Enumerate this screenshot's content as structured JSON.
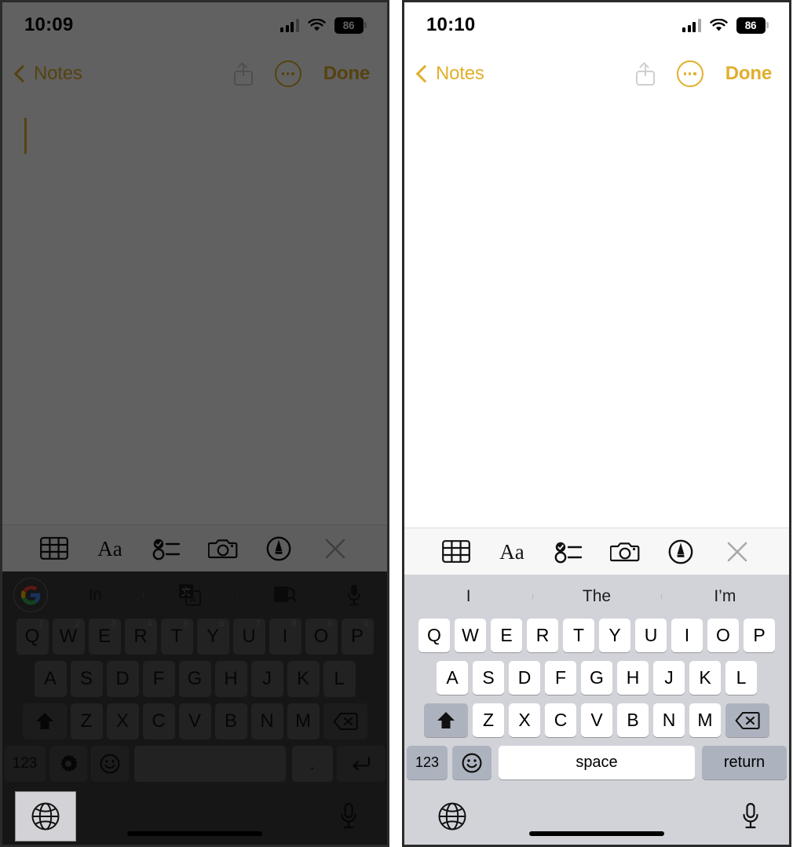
{
  "panels": [
    {
      "id": "left",
      "state": "dimmed",
      "status": {
        "time": "10:09",
        "battery": "86",
        "signal_icon": "cellular-bars-icon",
        "wifi_icon": "wifi-icon"
      },
      "navbar": {
        "back_label": "Notes",
        "back_icon": "chevron-left-icon",
        "share_icon": "share-icon",
        "more_icon": "ellipsis-circle-icon",
        "done_label": "Done"
      },
      "note": {
        "body_text": "",
        "caret": true
      },
      "toolbar": [
        {
          "name": "table-icon",
          "label": "Table"
        },
        {
          "name": "text-format-icon",
          "label": "Aa"
        },
        {
          "name": "checklist-icon",
          "label": "Checklist"
        },
        {
          "name": "camera-icon",
          "label": "Camera"
        },
        {
          "name": "markup-pen-icon",
          "label": "Markup"
        },
        {
          "name": "close-icon",
          "label": "Close"
        }
      ],
      "keyboard": {
        "type": "gboard",
        "suggestion_bar": {
          "logo_icon": "google-logo-icon",
          "suggestion": "In",
          "translate_icon": "google-translate-icon",
          "lens_icon": "google-lens-icon",
          "mic_icon": "microphone-icon"
        },
        "row1": [
          {
            "k": "Q",
            "n": "1"
          },
          {
            "k": "W",
            "n": "2"
          },
          {
            "k": "E",
            "n": "3"
          },
          {
            "k": "R",
            "n": "4"
          },
          {
            "k": "T",
            "n": "5"
          },
          {
            "k": "Y",
            "n": "6"
          },
          {
            "k": "U",
            "n": "7"
          },
          {
            "k": "I",
            "n": "8"
          },
          {
            "k": "O",
            "n": "9"
          },
          {
            "k": "P",
            "n": "0"
          }
        ],
        "row2": [
          "A",
          "S",
          "D",
          "F",
          "G",
          "H",
          "J",
          "K",
          "L"
        ],
        "row3": [
          "Z",
          "X",
          "C",
          "V",
          "B",
          "N",
          "M"
        ],
        "shift_icon": "shift-arrow-icon",
        "delete_icon": "delete-backward-icon",
        "numbers_label": "123",
        "settings_icon": "gear-icon",
        "emoji_icon": "emoji-smiley-icon",
        "space_label": "",
        "period_label": ".",
        "return_icon": "return-arrow-icon",
        "globe_icon": "globe-icon",
        "globe_highlighted": true,
        "mic_icon": "microphone-icon"
      }
    },
    {
      "id": "right",
      "state": "normal",
      "status": {
        "time": "10:10",
        "battery": "86",
        "signal_icon": "cellular-bars-icon",
        "wifi_icon": "wifi-icon"
      },
      "navbar": {
        "back_label": "Notes",
        "back_icon": "chevron-left-icon",
        "share_icon": "share-icon",
        "more_icon": "ellipsis-circle-icon",
        "done_label": "Done"
      },
      "note": {
        "body_text": "",
        "caret": false
      },
      "toolbar": [
        {
          "name": "table-icon",
          "label": "Table"
        },
        {
          "name": "text-format-icon",
          "label": "Aa"
        },
        {
          "name": "checklist-icon",
          "label": "Checklist"
        },
        {
          "name": "camera-icon",
          "label": "Camera"
        },
        {
          "name": "markup-pen-icon",
          "label": "Markup"
        },
        {
          "name": "close-icon",
          "label": "Close"
        }
      ],
      "keyboard": {
        "type": "ios",
        "predictions": [
          "I",
          "The",
          "I’m"
        ],
        "row1": [
          "Q",
          "W",
          "E",
          "R",
          "T",
          "Y",
          "U",
          "I",
          "O",
          "P"
        ],
        "row2": [
          "A",
          "S",
          "D",
          "F",
          "G",
          "H",
          "J",
          "K",
          "L"
        ],
        "row3": [
          "Z",
          "X",
          "C",
          "V",
          "B",
          "N",
          "M"
        ],
        "shift_icon": "shift-arrow-icon",
        "delete_icon": "delete-backward-icon",
        "numbers_label": "123",
        "emoji_icon": "emoji-smiley-icon",
        "space_label": "space",
        "return_label": "return",
        "globe_icon": "globe-icon",
        "globe_highlighted": false,
        "mic_icon": "microphone-icon"
      }
    }
  ],
  "colors": {
    "accent_gold": "#e0af2c",
    "ios_keyboard_bg": "#d1d3d9",
    "ios_key_white": "#ffffff",
    "ios_key_gray": "#adb3be",
    "gboard_bg": "#3a3a3a",
    "gboard_key": "#5a5a5a",
    "dim_overlay": "rgba(0,0,0,0.62)"
  }
}
